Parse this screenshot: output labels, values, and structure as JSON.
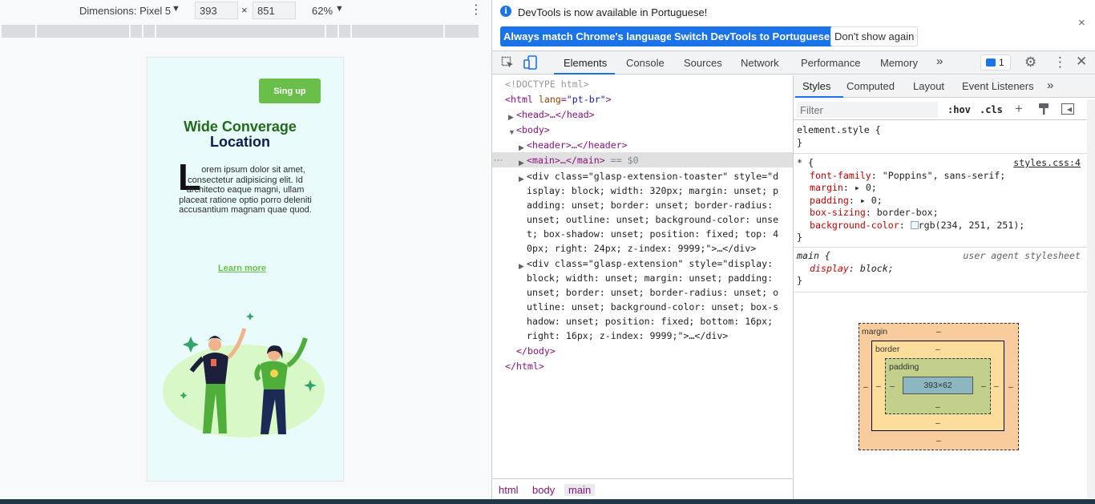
{
  "device_toolbar": {
    "dimensions_label": "Dimensions: Pixel 5",
    "width": "393",
    "height": "851",
    "times": "×",
    "zoom": "62%",
    "caret": "▼"
  },
  "phone": {
    "signup_label": "Sing up",
    "title_line1": "Wide Converage",
    "title_line2": "Location",
    "drop_cap": "L",
    "paragraph": "orem ipsum dolor sit amet, consectetur adipisicing elit. Id architecto eaque magni, ullam placeat ratione optio porro deleniti accusantium magnam quae quod.",
    "learn_more": "Learn more",
    "colors": {
      "background": "#eafbfb",
      "accent": "#6abf4b",
      "title_green": "#1f6b1a",
      "title_navy": "#0f1c4d"
    }
  },
  "infobar": {
    "icon": "i",
    "message": "DevTools is now available in Portuguese!",
    "btn_match": "Always match Chrome's language",
    "btn_switch": "Switch DevTools to Portuguese",
    "btn_dont": "Don't show again",
    "close": "×"
  },
  "main_tabs": {
    "elements": "Elements",
    "console": "Console",
    "sources": "Sources",
    "network": "Network",
    "performance": "Performance",
    "memory": "Memory",
    "more": "»",
    "issues_count": "1",
    "close": "✕"
  },
  "dom_tree": {
    "doctype": "<!DOCTYPE html>",
    "html_open": "<html ",
    "html_lang_attr": "lang",
    "html_lang_val": "\"pt-br\"",
    "head": "<head>…</head>",
    "body_open": "<body>",
    "header": "<header>…</header>",
    "main": "<main>…</main>",
    "main_eq": " == $0",
    "div1_lines": [
      "<div class=\"glasp-extension-toaster\" style=\"d",
      "isplay: block; width: 320px; margin: unset; p",
      "adding: unset; border: unset; border-radius:",
      "unset; outline: unset; background-color: unse",
      "t; box-shadow: unset; position: fixed; top: 4",
      "0px; right: 24px; z-index: 9999;\">…</div>"
    ],
    "div2_lines": [
      "<div class=\"glasp-extension\" style=\"display:",
      "block; width: unset; margin: unset; padding:",
      "unset; border: unset; border-radius: unset; o",
      "utline: unset; background-color: unset; box-s",
      "hadow: unset; position: fixed; bottom: 16px;",
      "right: 16px; z-index: 9999;\">…</div>"
    ],
    "body_close": "</body>",
    "html_close": "</html>",
    "dots": "···"
  },
  "breadcrumbs": {
    "html": "html",
    "body": "body",
    "main": "main"
  },
  "styles_tabs": {
    "styles": "Styles",
    "computed": "Computed",
    "layout": "Layout",
    "listeners": "Event Listeners",
    "more": "»"
  },
  "filter": {
    "placeholder": "Filter",
    "hov": ":hov",
    "cls": ".cls",
    "plus": "+"
  },
  "rules": {
    "element_style": "element.style {",
    "close_brace": "}",
    "star_selector": "* {",
    "star_source": "styles.css:4",
    "star_props": [
      {
        "name": "font-family",
        "value": "\"Poppins\", sans-serif;"
      },
      {
        "name": "margin",
        "value": "▸ 0;"
      },
      {
        "name": "padding",
        "value": "▸ 0;"
      },
      {
        "name": "box-sizing",
        "value": "border-box;"
      },
      {
        "name": "background-color",
        "value": "rgb(234, 251, 251);"
      }
    ],
    "main_selector": "main {",
    "main_source": "user agent stylesheet",
    "main_prop": {
      "name": "display",
      "value": "block;"
    }
  },
  "box_model": {
    "margin_label": "margin",
    "border_label": "border",
    "padding_label": "padding",
    "content_size": "393×62",
    "dash": "–"
  }
}
